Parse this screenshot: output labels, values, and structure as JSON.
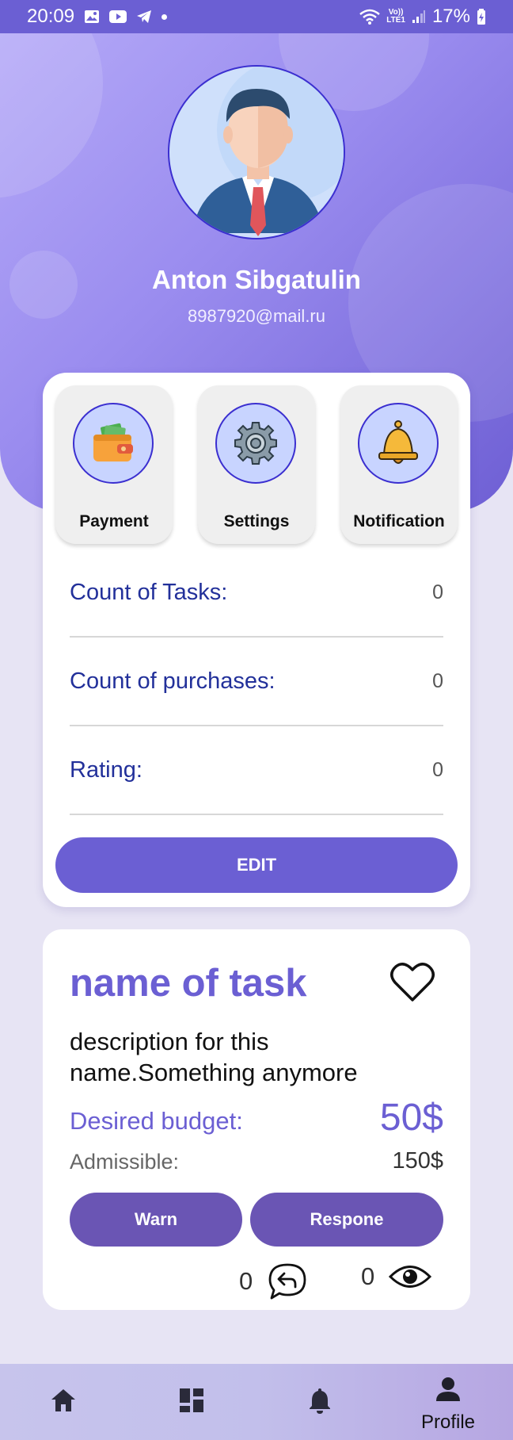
{
  "status_bar": {
    "time": "20:09",
    "left_icons": [
      "gallery-icon",
      "youtube-icon",
      "telegram-icon",
      "dot-icon"
    ],
    "right_icons": [
      "wifi-icon",
      "volte-icon",
      "signal-icon",
      "battery-charging-icon"
    ],
    "network_label_top": "Vo))",
    "network_label_bottom": "LTE1",
    "battery": "17%"
  },
  "profile": {
    "name": "Anton Sibgatulin",
    "email": "8987920@mail.ru",
    "avatar_icon": "businessman-avatar"
  },
  "quick_actions": [
    {
      "label": "Payment",
      "icon": "wallet-icon"
    },
    {
      "label": "Settings",
      "icon": "gear-icon"
    },
    {
      "label": "Notification",
      "icon": "bell-icon"
    }
  ],
  "stats": [
    {
      "label": "Count of Tasks:",
      "value": "0"
    },
    {
      "label": "Count of purchases:",
      "value": "0"
    },
    {
      "label": "Rating:",
      "value": "0"
    }
  ],
  "edit_label": "EDIT",
  "task": {
    "title": "name of task",
    "description": "description for this name.Something anymore",
    "budget_label": "Desired budget:",
    "budget_value": "50$",
    "admissible_label": "Admissible:",
    "admissible_value": "150$",
    "warn_label": "Warn",
    "respone_label": "Respone",
    "responses_count": "0",
    "views_count": "0"
  },
  "bottom_nav": [
    {
      "icon": "home-icon",
      "label": ""
    },
    {
      "icon": "dashboard-icon",
      "label": ""
    },
    {
      "icon": "bell-icon",
      "label": ""
    },
    {
      "icon": "person-icon",
      "label": "Profile",
      "active": true
    }
  ],
  "colors": {
    "accent": "#6b5fd3",
    "task_button": "#6a55b4",
    "stat_label": "#22309a",
    "background": "#e7e4f4"
  }
}
